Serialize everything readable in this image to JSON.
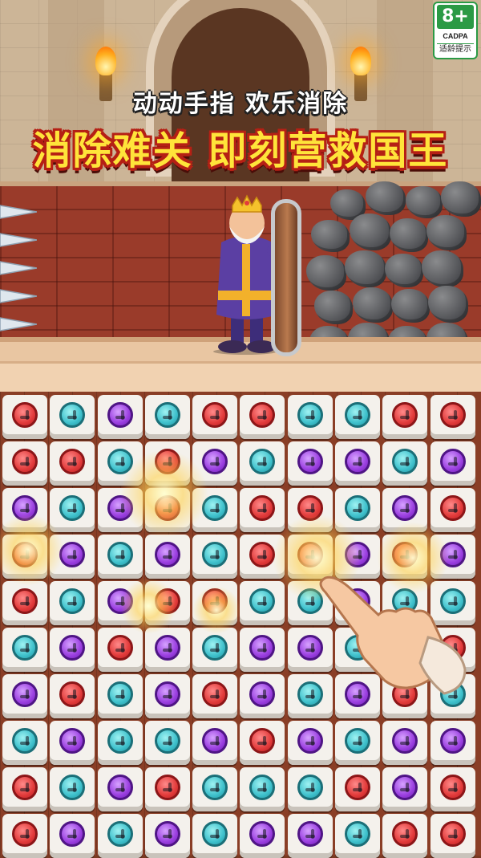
{
  "caption": "动动手指 欢乐消除",
  "headline": "消除难关 即刻营救国王",
  "age_badge": {
    "rating": "8+",
    "org": "CADPA",
    "tip": "适龄提示",
    "color": "#2b9a45"
  },
  "colors": {
    "red": "#e23b3b",
    "teal": "#3fc1cc",
    "purple": "#9b3fe0",
    "headline": "#ffe43a",
    "headline_outline": "#b52015"
  },
  "icons": [
    "torch-flame-icon",
    "spike-icon",
    "rock-icon",
    "door-shield-icon",
    "king-character",
    "pointing-hand-icon",
    "screw-icon"
  ],
  "board": {
    "rows": [
      [
        "red",
        "teal",
        "purple",
        "teal",
        "red",
        "red",
        "teal",
        "teal",
        "red",
        "red"
      ],
      [
        "red",
        "red",
        "teal",
        "red",
        "purple",
        "teal",
        "purple",
        "purple",
        "teal",
        "purple"
      ],
      [
        "purple",
        "teal",
        "purple",
        "red",
        "teal",
        "red",
        "red",
        "teal",
        "purple",
        "red"
      ],
      [
        "red",
        "purple",
        "teal",
        "purple",
        "teal",
        "red",
        "red",
        "purple",
        "red",
        "purple"
      ],
      [
        "red",
        "teal",
        "purple",
        "red",
        "red",
        "teal",
        "teal",
        "purple",
        "teal",
        "teal"
      ],
      [
        "teal",
        "purple",
        "red",
        "purple",
        "teal",
        "purple",
        "purple",
        "teal",
        "red",
        "red"
      ],
      [
        "purple",
        "red",
        "teal",
        "purple",
        "red",
        "purple",
        "teal",
        "purple",
        "red",
        "teal"
      ],
      [
        "teal",
        "purple",
        "teal",
        "teal",
        "purple",
        "red",
        "purple",
        "teal",
        "purple",
        "purple"
      ],
      [
        "red",
        "teal",
        "purple",
        "red",
        "teal",
        "teal",
        "teal",
        "red",
        "purple",
        "red"
      ],
      [
        "red",
        "purple",
        "teal",
        "purple",
        "teal",
        "purple",
        "purple",
        "teal",
        "red",
        "red"
      ]
    ]
  }
}
